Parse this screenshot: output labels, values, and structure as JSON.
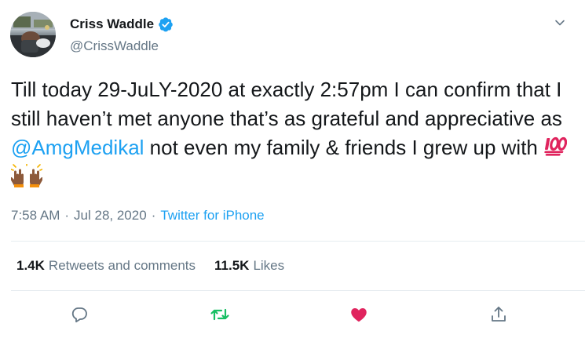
{
  "author": {
    "display_name": "Criss Waddle",
    "handle": "@CrissWaddle",
    "verified_icon": "verified-badge-icon"
  },
  "tweet": {
    "text_before": "Till today 29-JuLY-2020 at exactly 2:57pm I can confirm that I still haven’t met anyone that’s as grateful and appreciative as ",
    "mention": "@AmgMedikal",
    "text_after": " not even my family & friends I grew up with ",
    "emojis": [
      "hundred-points-icon",
      "raising-hands-icon"
    ]
  },
  "meta": {
    "time": "7:58 AM",
    "separator": "·",
    "date": "Jul 28, 2020",
    "source": "Twitter for iPhone"
  },
  "stats": {
    "retweets_count": "1.4K",
    "retweets_label": "Retweets and comments",
    "likes_count": "11.5K",
    "likes_label": "Likes"
  },
  "actions": [
    "reply-icon",
    "retweet-icon",
    "like-icon",
    "share-icon"
  ],
  "colors": {
    "accent": "#1da1f2",
    "retweet_green": "#17bf63",
    "like_red": "#e0245e",
    "muted": "#657786"
  }
}
